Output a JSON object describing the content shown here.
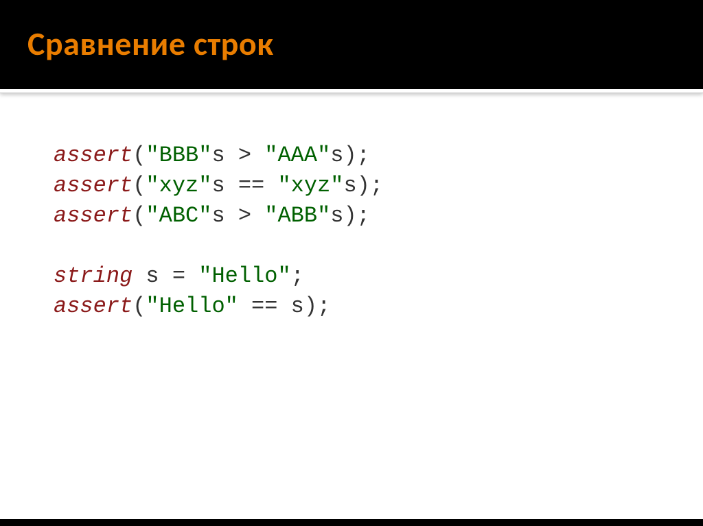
{
  "header": {
    "title": "Сравнение строк"
  },
  "code": {
    "lines": [
      {
        "t": "assert",
        "kw": "assert",
        "p1": "(",
        "s1": "\"BBB\"",
        "a1": "s > ",
        "s2": "\"AAA\"",
        "a2": "s);"
      },
      {
        "t": "assert",
        "kw": "assert",
        "p1": "(",
        "s1": "\"xyz\"",
        "a1": "s == ",
        "s2": "\"xyz\"",
        "a2": "s);"
      },
      {
        "t": "assert",
        "kw": "assert",
        "p1": "(",
        "s1": "\"ABC\"",
        "a1": "s > ",
        "s2": "\"ABB\"",
        "a2": "s);"
      },
      {
        "t": "blank"
      },
      {
        "t": "decl",
        "typ": "string",
        "mid": " s = ",
        "s1": "\"Hello\"",
        "end": ";"
      },
      {
        "t": "assert",
        "kw": "assert",
        "p1": "(",
        "s1": "\"Hello\"",
        "a1": " == s);",
        "s2": "",
        "a2": ""
      }
    ]
  }
}
